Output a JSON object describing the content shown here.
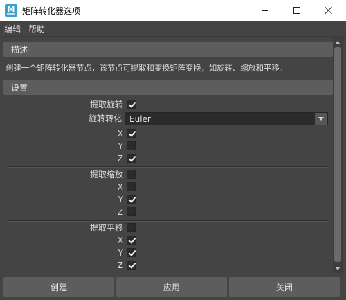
{
  "window": {
    "title": "矩阵转化器选项",
    "app_icon_letter": "M"
  },
  "menubar": {
    "items": [
      "编辑",
      "帮助"
    ]
  },
  "description": {
    "header": "描述",
    "text": "创建一个矩阵转化器节点，该节点可提取和变换矩阵变换，如旋转、缩放和平移。"
  },
  "settings": {
    "header": "设置",
    "extract_rotate": {
      "label": "提取旋转",
      "checked": true
    },
    "rotate_convert": {
      "label": "旋转转化",
      "value": "Euler"
    },
    "rotate_axes": [
      {
        "label": "X",
        "checked": true
      },
      {
        "label": "Y",
        "checked": false
      },
      {
        "label": "Z",
        "checked": true
      }
    ],
    "extract_scale": {
      "label": "提取缩放",
      "checked": false
    },
    "scale_axes": [
      {
        "label": "X",
        "checked": false
      },
      {
        "label": "Y",
        "checked": true
      },
      {
        "label": "Z",
        "checked": false
      }
    ],
    "extract_translate": {
      "label": "提取平移",
      "checked": false
    },
    "translate_axes": [
      {
        "label": "X",
        "checked": true
      },
      {
        "label": "Y",
        "checked": true
      },
      {
        "label": "Z",
        "checked": true
      }
    ]
  },
  "buttons": {
    "create": "创建",
    "apply": "应用",
    "close": "关闭"
  }
}
